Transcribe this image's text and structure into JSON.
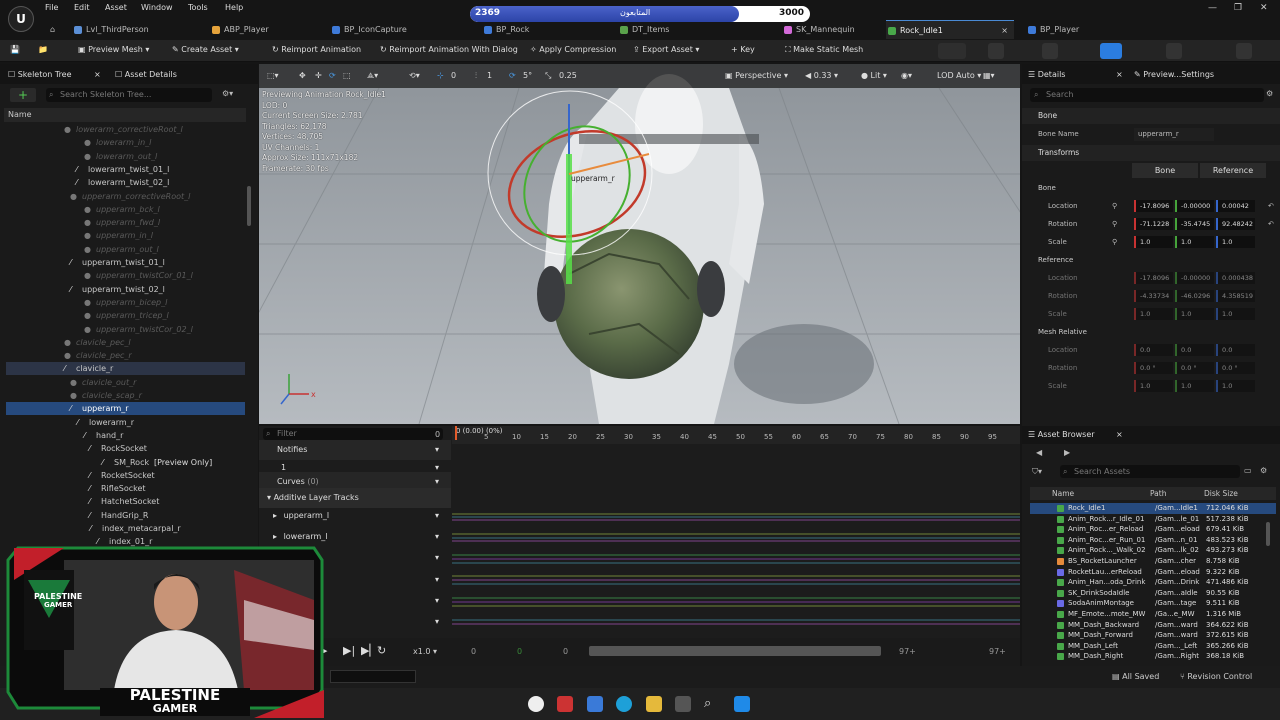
{
  "menu": [
    "File",
    "Edit",
    "Asset",
    "Window",
    "Tools",
    "Help"
  ],
  "tabs": [
    {
      "label": "Lvl_ThirdPerson",
      "color": "#5b8fd6"
    },
    {
      "label": "ABP_Player",
      "color": "#e5a33b"
    },
    {
      "label": "BP_IconCapture",
      "color": "#3e7ad8"
    },
    {
      "label": "BP_Rock",
      "color": "#3e7ad8"
    },
    {
      "label": "DT_Items",
      "color": "#5aa24b"
    },
    {
      "label": "SK_Mannequin",
      "color": "#d36ad8"
    },
    {
      "label": "Rock_Idle1",
      "color": "#49a84a"
    },
    {
      "label": "BP_Player",
      "color": "#3e7ad8"
    }
  ],
  "progress": {
    "current": "2369",
    "goal": "3000",
    "label": "المتابعون",
    "fraction": 0.79
  },
  "toolbar": [
    "Preview Mesh",
    "Create Asset",
    "Reimport Animation",
    "Reimport Animation With Dialog",
    "Apply Compression",
    "Export Asset",
    "Key",
    "Make Static Mesh"
  ],
  "left": {
    "tab1": "Skeleton Tree",
    "tab2": "Asset Details",
    "search_placeholder": "Search Skeleton Tree...",
    "col_name": "Name",
    "tree": [
      {
        "label": "lowerarm_correctiveRoot_l",
        "dim": true,
        "ind": 70
      },
      {
        "label": "lowerarm_in_l",
        "dim": true,
        "ind": 90
      },
      {
        "label": "lowerarm_out_l",
        "dim": true,
        "ind": 90
      },
      {
        "label": "lowerarm_twist_01_l",
        "dim": false,
        "ind": 82
      },
      {
        "label": "lowerarm_twist_02_l",
        "dim": false,
        "ind": 82
      },
      {
        "label": "upperarm_correctiveRoot_l",
        "dim": true,
        "ind": 76
      },
      {
        "label": "upperarm_bck_l",
        "dim": true,
        "ind": 90
      },
      {
        "label": "upperarm_fwd_l",
        "dim": true,
        "ind": 90
      },
      {
        "label": "upperarm_in_l",
        "dim": true,
        "ind": 90
      },
      {
        "label": "upperarm_out_l",
        "dim": true,
        "ind": 90
      },
      {
        "label": "upperarm_twist_01_l",
        "dim": false,
        "ind": 76
      },
      {
        "label": "upperarm_twistCor_01_l",
        "dim": true,
        "ind": 90
      },
      {
        "label": "upperarm_twist_02_l",
        "dim": false,
        "ind": 76
      },
      {
        "label": "upperarm_bicep_l",
        "dim": true,
        "ind": 90
      },
      {
        "label": "upperarm_tricep_l",
        "dim": true,
        "ind": 90
      },
      {
        "label": "upperarm_twistCor_02_l",
        "dim": true,
        "ind": 90
      },
      {
        "label": "clavicle_pec_l",
        "dim": true,
        "ind": 70
      },
      {
        "label": "clavicle_pec_r",
        "dim": true,
        "ind": 70
      },
      {
        "label": "clavicle_r",
        "dim": false,
        "ind": 70
      },
      {
        "label": "clavicle_out_r",
        "dim": true,
        "ind": 76
      },
      {
        "label": "clavicle_scap_r",
        "dim": true,
        "ind": 76
      },
      {
        "label": "upperarm_r",
        "dim": false,
        "ind": 76
      },
      {
        "label": "lowerarm_r",
        "dim": false,
        "ind": 83
      },
      {
        "label": "hand_r",
        "dim": false,
        "ind": 90
      },
      {
        "label": "RockSocket",
        "dim": false,
        "ind": 95
      },
      {
        "label": "SM_Rock",
        "extra": "[Preview Only]",
        "dim": false,
        "ind": 108
      },
      {
        "label": "RocketSocket",
        "dim": false,
        "ind": 95
      },
      {
        "label": "RifleSocket",
        "dim": false,
        "ind": 95
      },
      {
        "label": "HatchetSocket",
        "dim": false,
        "ind": 95
      },
      {
        "label": "HandGrip_R",
        "dim": false,
        "ind": 95
      },
      {
        "label": "index_metacarpal_r",
        "dim": false,
        "ind": 96
      },
      {
        "label": "index_01_r",
        "dim": false,
        "ind": 103
      }
    ]
  },
  "viewport": {
    "perspective": "Perspective",
    "fov": "0.33",
    "lit": "Lit",
    "lod": "LOD Auto",
    "snap1": "0",
    "snap2": "1",
    "snap3": "5°",
    "snap4": "0.25",
    "info": [
      "Previewing Animation Rock_Idle1",
      "LOD: 0",
      "Current Screen Size: 2.781",
      "Triangles: 62,178",
      "Vertices: 48,705",
      "UV Channels: 1",
      "Approx Size: 111x71x182",
      "Framerate: 30 fps"
    ],
    "bone_label": "upperarm_r"
  },
  "details": {
    "tab1": "Details",
    "tab2": "Preview...Settings",
    "search": "Search",
    "bone_section": "Bone",
    "bone_name_label": "Bone Name",
    "bone_name": "upperarm_r",
    "transforms": "Transforms",
    "btn_bone": "Bone",
    "btn_reference": "Reference",
    "bone_group": "Bone",
    "reference_group": "Reference",
    "mesh_relative": "Mesh Relative",
    "loc": "Location",
    "rot": "Rotation",
    "scale": "Scale",
    "bone_loc": [
      "-17.8096",
      "-0.00000",
      "0.00042"
    ],
    "bone_rot": [
      "-71.1228",
      "-35.4745",
      "92.48242"
    ],
    "bone_scale": [
      "1.0",
      "1.0",
      "1.0"
    ],
    "ref_loc": [
      "-17.8096",
      "-0.00000",
      "0.000438"
    ],
    "ref_rot": [
      "-4.33734",
      "-46.0296",
      "4.358519"
    ],
    "ref_scale": [
      "1.0",
      "1.0",
      "1.0"
    ],
    "mesh_loc": [
      "0.0",
      "0.0",
      "0.0"
    ],
    "mesh_rot": [
      "0.0 °",
      "0.0 °",
      "0.0 °"
    ],
    "mesh_scale": [
      "1.0",
      "1.0",
      "1.0"
    ]
  },
  "timeline": {
    "filter": "Filter",
    "count": "0",
    "frame_label": "0 (0.00) (0%)",
    "ticks": [
      "0",
      "5",
      "10",
      "15",
      "20",
      "25",
      "30",
      "35",
      "40",
      "45",
      "50",
      "55",
      "60",
      "65",
      "70",
      "75",
      "80",
      "85",
      "90",
      "95"
    ],
    "notifies": "Notifies",
    "notify_row": "1",
    "curves": "Curves",
    "curves_count": "(0)",
    "additive": "Additive Layer Tracks",
    "track1": "upperarm_l",
    "track2": "lowerarm_l",
    "speed": "x1.0",
    "f_start": "0",
    "f_cur": "0",
    "f_end_l": "0",
    "f97a": "97+",
    "f97b": "97+"
  },
  "assets": {
    "title": "Asset Browser",
    "search": "Search Assets",
    "cols": [
      "Name",
      "Path",
      "Disk Size"
    ],
    "rows": [
      {
        "n": "Rock_Idle1",
        "p": "/Gam...Idle1",
        "s": "712.046 KiB",
        "c": "#49a84a"
      },
      {
        "n": "Anim_Rock...r_Idle_01",
        "p": "/Gam...le_01",
        "s": "517.238 KiB",
        "c": "#49a84a"
      },
      {
        "n": "Anim_Roc...er_Reload",
        "p": "/Gam...eload",
        "s": "679.41 KiB",
        "c": "#49a84a"
      },
      {
        "n": "Anim_Roc...er_Run_01",
        "p": "/Gam...n_01",
        "s": "483.523 KiB",
        "c": "#49a84a"
      },
      {
        "n": "Anim_Rock..._Walk_02",
        "p": "/Gam...lk_02",
        "s": "493.273 KiB",
        "c": "#49a84a"
      },
      {
        "n": "BS_RocketLauncher",
        "p": "/Gam...cher",
        "s": "8.758 KiB",
        "c": "#e58a3b"
      },
      {
        "n": "RocketLau...erReload",
        "p": "/Gam...eload",
        "s": "9.322 KiB",
        "c": "#6a6ae5"
      },
      {
        "n": "Anim_Han...oda_Drink",
        "p": "/Gam...Drink",
        "s": "471.486 KiB",
        "c": "#49a84a"
      },
      {
        "n": "SK_DrinkSodaIdle",
        "p": "/Gam...aIdle",
        "s": "90.55 KiB",
        "c": "#49a84a"
      },
      {
        "n": "SodaAnimMontage",
        "p": "/Gam...tage",
        "s": "9.511 KiB",
        "c": "#6a6ae5"
      },
      {
        "n": "MF_Emote...mote_MW",
        "p": "/Ga...e_MW",
        "s": "1.316 MiB",
        "c": "#49a84a"
      },
      {
        "n": "MM_Dash_Backward",
        "p": "/Gam...ward",
        "s": "364.622 KiB",
        "c": "#49a84a"
      },
      {
        "n": "MM_Dash_Forward",
        "p": "/Gam...ward",
        "s": "372.615 KiB",
        "c": "#49a84a"
      },
      {
        "n": "MM_Dash_Left",
        "p": "/Gam..._Left",
        "s": "365.266 KiB",
        "c": "#49a84a"
      },
      {
        "n": "MM_Dash_Right",
        "p": "/Gam...Right",
        "s": "368.18 KiB",
        "c": "#49a84a"
      }
    ]
  },
  "status": {
    "saved": "All Saved",
    "revision": "Revision Control"
  },
  "webcam": {
    "name1": "PALESTINE",
    "name2": "GAMER",
    "logo1": "PALESTINE",
    "logo2": "GAMER"
  }
}
